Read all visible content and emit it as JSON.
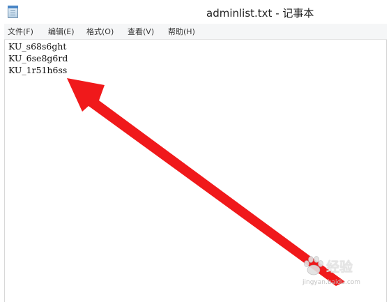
{
  "window": {
    "title": "adminlist.txt - 记事本"
  },
  "menu": {
    "items": [
      {
        "label": "文件(F)"
      },
      {
        "label": "编辑(E)"
      },
      {
        "label": "格式(O)"
      },
      {
        "label": "查看(V)"
      },
      {
        "label": "帮助(H)"
      }
    ]
  },
  "editor": {
    "lines": [
      "KU_s68s6ght",
      "KU_6se8g6rd",
      "KU_1r51h6ss"
    ]
  },
  "annotation": {
    "arrow_color": "#f0191b"
  },
  "watermark": {
    "logo_text": "经验",
    "url": "jingyan.baidu.com"
  }
}
